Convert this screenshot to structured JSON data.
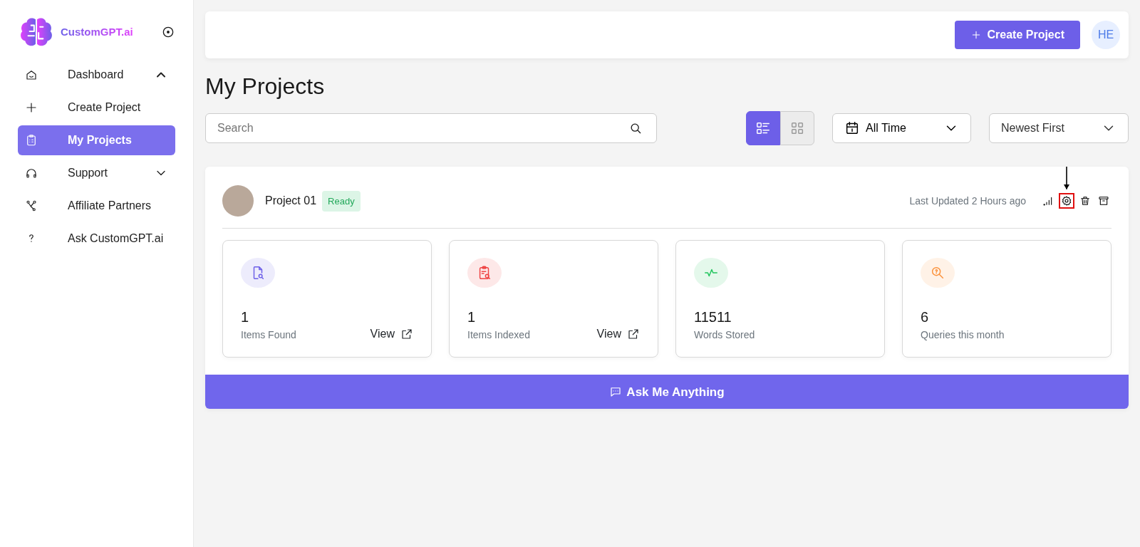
{
  "brand": {
    "name": "CustomGPT.ai"
  },
  "sidebar": {
    "items": [
      {
        "label": "Dashboard",
        "selected": false,
        "expanded": true
      },
      {
        "label": "Create Project",
        "selected": false
      },
      {
        "label": "My Projects",
        "selected": true
      },
      {
        "label": "Support",
        "selected": false,
        "expanded": false
      },
      {
        "label": "Affiliate Partners",
        "selected": false
      },
      {
        "label": "Ask CustomGPT.ai",
        "selected": false
      }
    ]
  },
  "header": {
    "create_button": "Create Project",
    "avatar": "HE"
  },
  "page_title": "My Projects",
  "search": {
    "placeholder": "Search"
  },
  "view_toggle": [
    {
      "kind": "list",
      "selected": true
    },
    {
      "kind": "grid",
      "selected": false
    }
  ],
  "date_filter": {
    "value": "All Time"
  },
  "sort": {
    "value": "Newest First"
  },
  "project": {
    "name": "Project 01",
    "status": "Ready",
    "last_updated": "Last Updated 2 Hours ago",
    "actions": [
      {
        "kind": "stats",
        "highlighted": false
      },
      {
        "kind": "settings",
        "highlighted": true
      },
      {
        "kind": "delete",
        "highlighted": false
      },
      {
        "kind": "archive",
        "highlighted": false
      }
    ],
    "stats": [
      {
        "kind": "document",
        "value": "1",
        "label": "Items Found",
        "link": "View",
        "color": "#6d5fe8"
      },
      {
        "kind": "clipboard",
        "value": "1",
        "label": "Items Indexed",
        "link": "View",
        "color": "#ef4444"
      },
      {
        "kind": "pulse",
        "value": "11511",
        "label": "Words Stored",
        "color": "#22c55e"
      },
      {
        "kind": "query",
        "value": "6",
        "label": "Queries this month",
        "color": "#fb923c"
      }
    ],
    "ask_button": "Ask Me Anything"
  }
}
